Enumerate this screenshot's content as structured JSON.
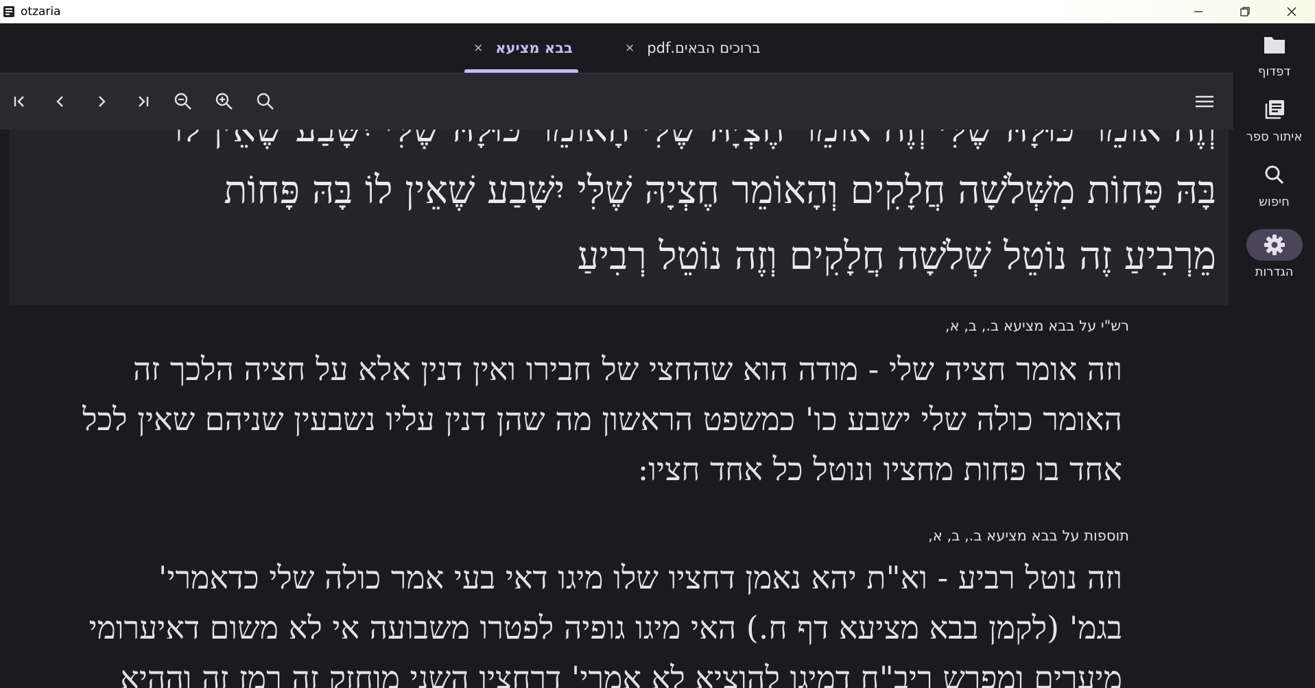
{
  "window": {
    "title": "otzaria",
    "minimize_glyph": "—",
    "restore_glyph": "❐",
    "close_glyph": "✕"
  },
  "tabs": [
    {
      "label": "בבא מציעא",
      "close": "×",
      "active": true
    },
    {
      "label": "ברוכים הבאים.pdf",
      "close": "×",
      "active": false
    }
  ],
  "toolbar": {
    "icons": [
      "first-page-icon",
      "previous-page-icon",
      "next-page-icon",
      "last-page-icon",
      "zoom-out-icon",
      "zoom-in-icon",
      "search-icon",
      "menu-icon"
    ]
  },
  "rail": {
    "items": [
      {
        "label": "דפדוף",
        "icon": "folder-icon"
      },
      {
        "label": "איתור ספר",
        "icon": "library-icon"
      },
      {
        "label": "חיפוש",
        "icon": "search-icon"
      },
      {
        "label": "הגדרות",
        "icon": "gear-icon",
        "active": true
      }
    ]
  },
  "main_text": {
    "clipped_line": "וְזֶה אוֹמֵר כּוּלָּהּ שֶׁלִּי וְזֶה אוֹמֵר חֶצְיָהּ שֶׁלִּי הָאוֹמֵר כּוּלָּהּ שֶׁלִּי יִשָּׁבַע שֶׁאֵין לוֹ",
    "line1": "בָּהּ פָּחוֹת מִשְּׁלֹשָׁה חֲלָקִים וְהָאוֹמֵר חֶצְיָהּ שֶׁלִּי יִשָּׁבַע שֶׁאֵין לוֹ בָּהּ פָּחוֹת",
    "line2": "מֵרְבִיעַ זֶה נוֹטֵל שְׁלֹשָׁה חֲלָקִים וְזֶה נוֹטֵל רְבִיעַ"
  },
  "commentaries": [
    {
      "title": "רש\"י על בבא מציעא ב., ב, א,",
      "lines": [
        "וזה אומר חציה שלי - מודה הוא שהחצי של חבירו ואין דנין אלא על חציה הלכך זה",
        "האומר כולה שלי ישבע כו' כמשפט הראשון מה שהן דנין עליו נשבעין שניהם שאין לכל",
        "אחד בו פחות מחציו ונוטל כל אחד חציו:"
      ]
    },
    {
      "title": "תוספות על בבא מציעא ב., ב, א,",
      "lines": [
        "וזה נוטל רביע - וא\"ת יהא נאמן דחציו שלו מיגו דאי בעי אמר כולה שלי כדאמרי'",
        "בגמ' (לקמן בבא מציעא דף ח.) האי מיגו גופיה לפטרו משבועה אי לא משום דאיערומי",
        "מיערים ומפרש ריב\"ח דמיגו להוציא לא אמרי' דרחציו השני מוחזק זה רמז זה וההיא"
      ]
    }
  ]
}
